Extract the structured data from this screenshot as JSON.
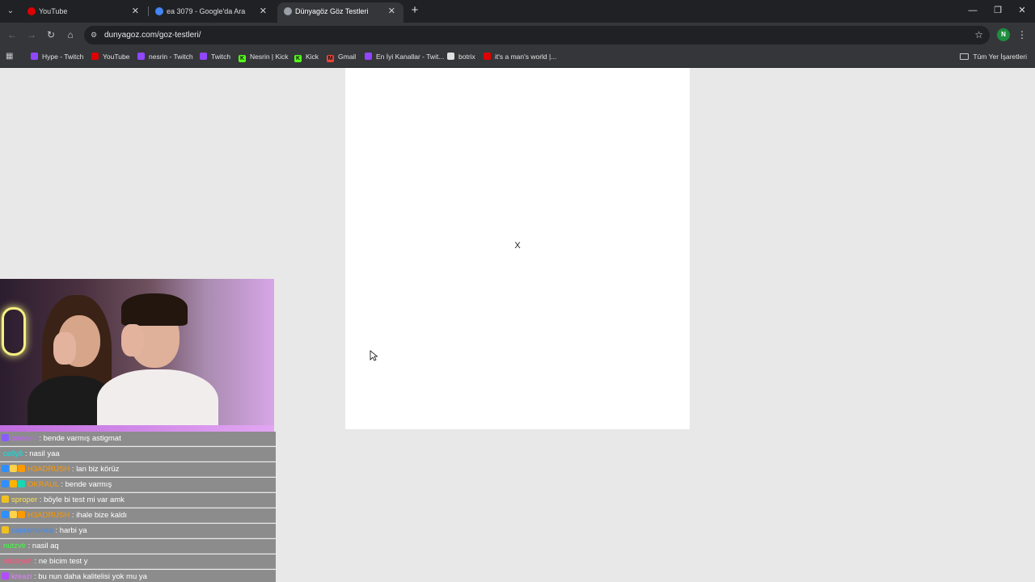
{
  "browser": {
    "tabs": [
      {
        "title": "YouTube",
        "favicon_color": "#e00000"
      },
      {
        "title": "ea 3079 - Google'da Ara",
        "favicon_color": "#4285f4"
      },
      {
        "title": "Dünyagöz Göz Testleri",
        "favicon_color": "#9aa0a6",
        "active": true
      }
    ],
    "url": "dunyagoz.com/goz-testleri/",
    "profile_initial": "N",
    "bookmarks": [
      {
        "label": "Hype - Twitch",
        "icon_color": "#9146ff"
      },
      {
        "label": "YouTube",
        "icon_color": "#e00000"
      },
      {
        "label": "nesrin - Twitch",
        "icon_color": "#9146ff"
      },
      {
        "label": "Twitch",
        "icon_color": "#9146ff"
      },
      {
        "label": "Nesrin | Kick",
        "icon_color": "#53fc18",
        "icon_text": "K"
      },
      {
        "label": "Kick",
        "icon_color": "#53fc18",
        "icon_text": "K"
      },
      {
        "label": "Gmail",
        "icon_color": "#ea4335",
        "icon_text": "M"
      },
      {
        "label": "En İyi Kanallar - Twit...",
        "icon_color": "#9146ff"
      },
      {
        "label": "botrix",
        "icon_color": "#e0e0e0"
      },
      {
        "label": "it's a man's world |...",
        "icon_color": "#e00000"
      }
    ],
    "all_bookmarks_label": "Tüm Yer İşaretleri"
  },
  "page": {
    "test_symbol": "X"
  },
  "chat": [
    {
      "user": "ondeen",
      "user_color": "#c060ff",
      "message": "bende varmış astigmat",
      "badges": [
        "#8a5cff"
      ]
    },
    {
      "user": "celly8",
      "user_color": "#00e5e5",
      "message": "nasil yaa",
      "badges": []
    },
    {
      "user": "H3ADRUSH",
      "user_color": "#ff9900",
      "message": "lan biz körüz",
      "badges": [
        "#2f8fff",
        "#ffd24a",
        "#ff9900"
      ]
    },
    {
      "user": "OKRAUL",
      "user_color": "#ff9900",
      "message": "bende varmış",
      "badges": [
        "#2f8fff",
        "#ffb300",
        "#1ad6b5"
      ]
    },
    {
      "user": "sproper",
      "user_color": "#ffe14a",
      "message": "böyle bi test mi var amk",
      "badges": [
        "#f0c020"
      ]
    },
    {
      "user": "H3ADRUSH",
      "user_color": "#ff9900",
      "message": "ihale bize kaldı",
      "badges": [
        "#2f8fff",
        "#ffd24a",
        "#ff9900"
      ]
    },
    {
      "user": "saptamonka",
      "user_color": "#3a8dff",
      "message": "harbi ya",
      "badges": [
        "#f0c020"
      ]
    },
    {
      "user": "nutzvlr",
      "user_color": "#40ff40",
      "message": "nasil aq",
      "badges": []
    },
    {
      "user": "mbalyeh",
      "user_color": "#ff4f7a",
      "message": "ne bicim test y",
      "badges": []
    },
    {
      "user": "kreazi",
      "user_color": "#e080ff",
      "message": "bu nun daha kalitelisi yok mu ya",
      "badges": [
        "#b44cff"
      ]
    }
  ]
}
